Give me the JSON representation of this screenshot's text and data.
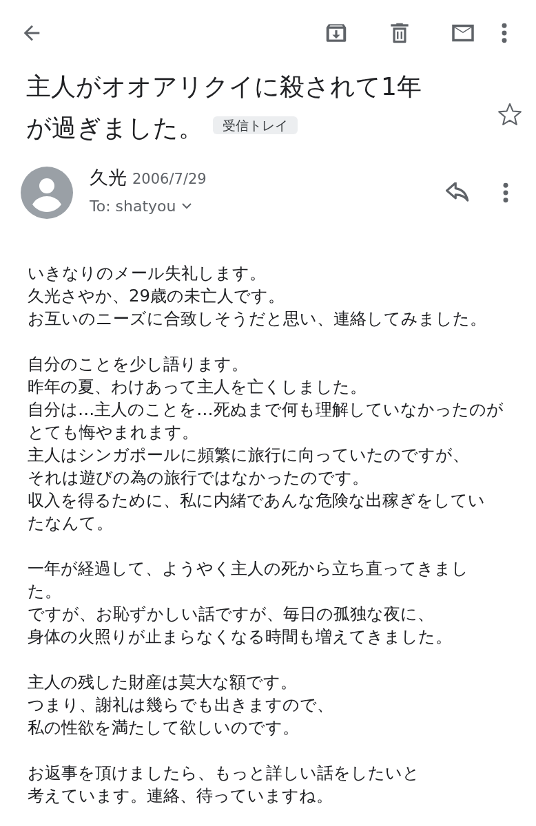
{
  "subject": {
    "lines": [
      "主人がオオアリクイに殺されて1年",
      "が過ぎました。"
    ],
    "label": "受信トレイ",
    "starred": false
  },
  "sender": {
    "name": "久光",
    "date": "2006/7/29",
    "to": "To: shatyou"
  },
  "body": [
    [
      "いきなりのメール失礼します。",
      "久光さやか、29歳の未亡人です。",
      "お互いのニーズに合致しそうだと思い、連絡してみました。"
    ],
    [
      "自分のことを少し語ります。",
      "昨年の夏、わけあって主人を亡くしました。",
      "自分は…主人のことを…死ぬまで何も理解していなかったのが",
      "とても悔やまれます。",
      "主人はシンガポールに頻繁に旅行に向っていたのですが、",
      "それは遊びの為の旅行ではなかったのです。",
      "収入を得るために、私に内緒であんな危険な出稼ぎをしてい",
      "たなんて。"
    ],
    [
      "一年が経過して、ようやく主人の死から立ち直ってきまし",
      "た。",
      "ですが、お恥ずかしい話ですが、毎日の孤独な夜に、",
      "身体の火照りが止まらなくなる時間も増えてきました。"
    ],
    [
      "主人の残した財産は莫大な額です。",
      "つまり、謝礼は幾らでも出きますので、",
      "私の性欲を満たして欲しいのです。"
    ],
    [
      "お返事を頂けましたら、もっと詳しい話をしたいと",
      "考えています。連絡、待っていますね。"
    ]
  ]
}
